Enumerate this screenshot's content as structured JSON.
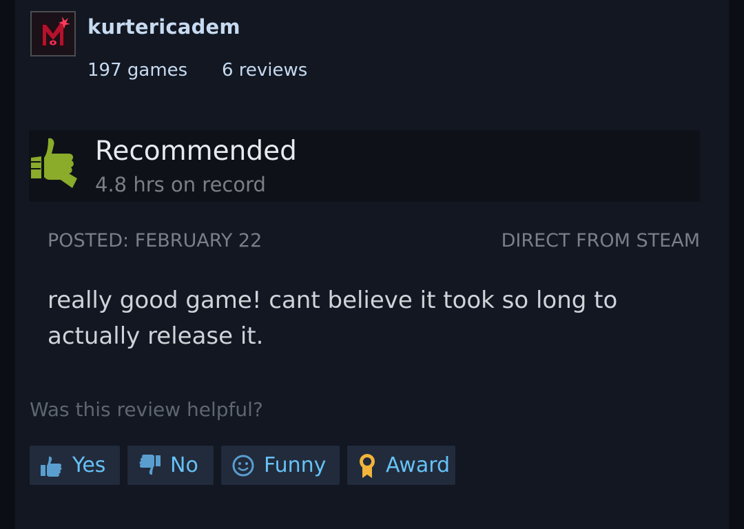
{
  "author": {
    "name": "kurtericadem",
    "games": "197 games",
    "reviews": "6 reviews"
  },
  "recommendation": {
    "title": "Recommended",
    "hours": "4.8 hrs on record",
    "icon": "thumbs-up-icon",
    "icon_color": "#8bab2a"
  },
  "meta": {
    "posted": "POSTED: FEBRUARY 22",
    "source": "DIRECT FROM STEAM"
  },
  "review": {
    "text": "really good game! cant believe it took so long to actually release it."
  },
  "helpful": {
    "prompt": "Was this review helpful?",
    "buttons": {
      "yes": "Yes",
      "no": "No",
      "funny": "Funny",
      "award": "Award"
    }
  },
  "colors": {
    "background": "#121722",
    "link": "#67c1f5",
    "button_bg": "#212b3c",
    "award_gold": "#f2b43a"
  }
}
